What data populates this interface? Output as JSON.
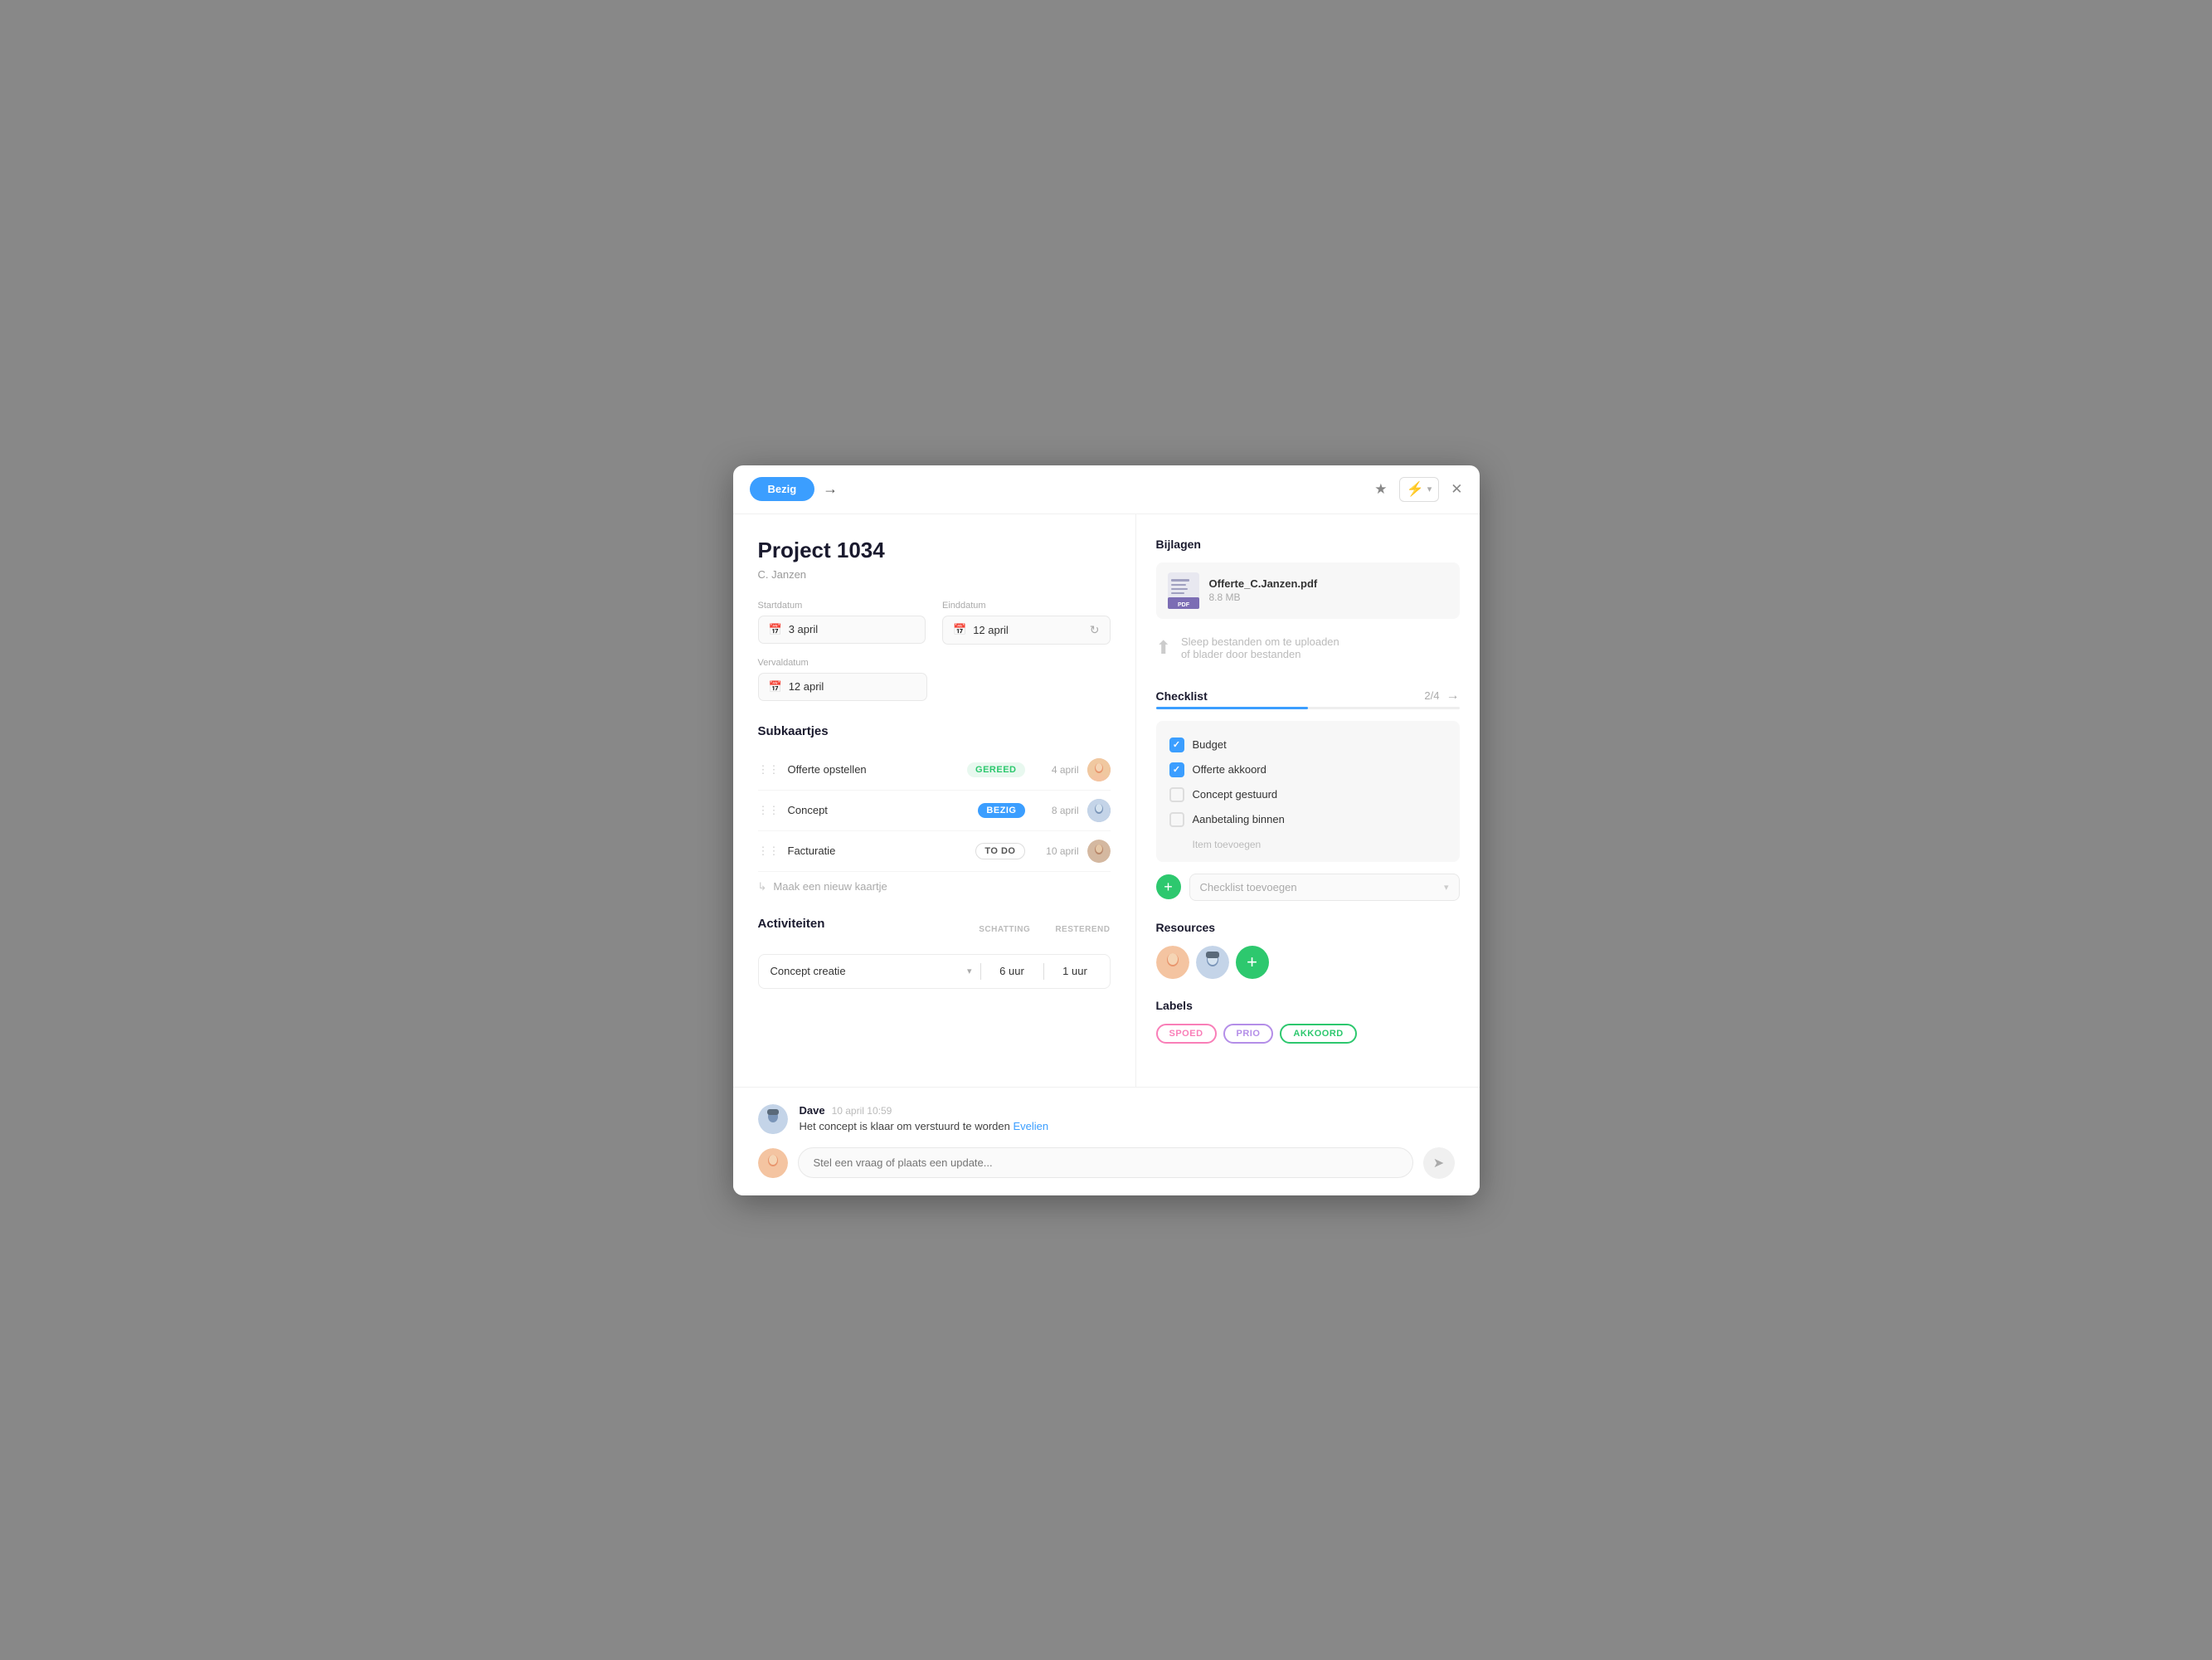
{
  "topbar": {
    "status_label": "Bezig",
    "arrow": "→",
    "star_icon": "★",
    "lightning_icon": "⚡",
    "chevron_icon": "▾",
    "close_icon": "✕"
  },
  "project": {
    "title": "Project 1034",
    "subtitle": "C. Janzen"
  },
  "dates": {
    "startdatum_label": "Startdatum",
    "einddatum_label": "Einddatum",
    "vervaldatum_label": "Vervaldatum",
    "startdatum_val": "3 april",
    "einddatum_val": "12 april",
    "vervaldatum_val": "12 april"
  },
  "subkaartjes": {
    "title": "Subkaartjes",
    "items": [
      {
        "name": "Offerte opstellen",
        "badge": "GEREED",
        "badge_type": "gereed",
        "date": "4 april"
      },
      {
        "name": "Concept",
        "badge": "BEZIG",
        "badge_type": "bezig",
        "date": "8 april"
      },
      {
        "name": "Facturatie",
        "badge": "TO DO",
        "badge_type": "todo",
        "date": "10 april"
      }
    ],
    "new_card_label": "Maak een nieuw kaartje"
  },
  "activiteiten": {
    "title": "Activiteiten",
    "col_schatting": "SCHATTING",
    "col_resterend": "RESTEREND",
    "items": [
      {
        "name": "Concept creatie",
        "schatting": "6 uur",
        "resterend": "1 uur"
      }
    ]
  },
  "bijlagen": {
    "title": "Bijlagen",
    "files": [
      {
        "name": "Offerte_C.Janzen.pdf",
        "size": "8.8 MB"
      }
    ],
    "upload_text": "Sleep bestanden om te uploaden",
    "upload_text2": "of blader door bestanden"
  },
  "checklist": {
    "title": "Checklist",
    "count": "2/4",
    "progress": 50,
    "items": [
      {
        "label": "Budget",
        "checked": true
      },
      {
        "label": "Offerte akkoord",
        "checked": true
      },
      {
        "label": "Concept gestuurd",
        "checked": false
      },
      {
        "label": "Aanbetaling binnen",
        "checked": false
      }
    ],
    "add_item_label": "Item toevoegen",
    "add_checklist_placeholder": "Checklist toevoegen"
  },
  "resources": {
    "title": "Resources"
  },
  "labels": {
    "title": "Labels",
    "items": [
      {
        "label": "SPOED",
        "type": "spoed"
      },
      {
        "label": "PRIO",
        "type": "prio"
      },
      {
        "label": "AKKOORD",
        "type": "akkoord"
      }
    ]
  },
  "comments": {
    "items": [
      {
        "author": "Dave",
        "time": "10 april 10:59",
        "text": "Het concept is klaar om verstuurd te worden ",
        "mention": "Evelien"
      }
    ],
    "input_placeholder": "Stel een vraag of plaats een update..."
  }
}
